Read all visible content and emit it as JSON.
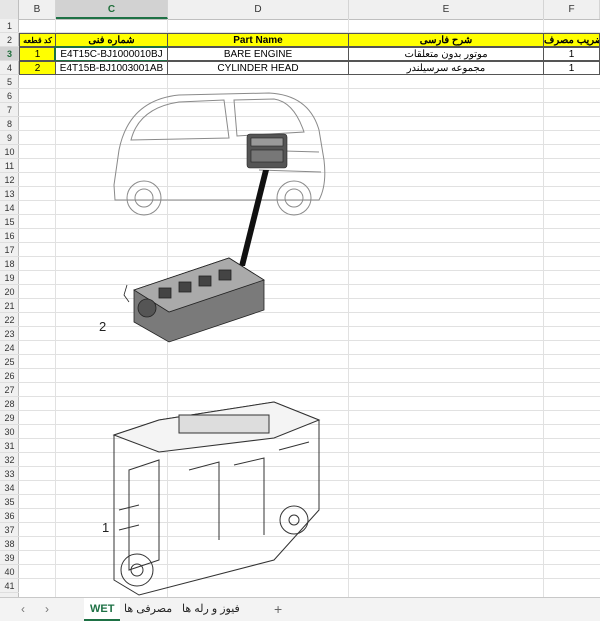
{
  "columns": [
    "B",
    "C",
    "D",
    "E",
    "F"
  ],
  "rows": [
    "1",
    "2",
    "3",
    "4",
    "5",
    "6",
    "7",
    "8",
    "9",
    "10",
    "11",
    "12",
    "13",
    "14",
    "15",
    "16",
    "17",
    "18",
    "19",
    "20",
    "21",
    "22",
    "23",
    "24",
    "25",
    "26",
    "27",
    "28",
    "29",
    "30",
    "31",
    "32",
    "33",
    "34",
    "35",
    "36",
    "37",
    "38",
    "39",
    "40",
    "41"
  ],
  "table": {
    "headers": {
      "b": "کد قطعه",
      "c": "شماره فنی",
      "d": "Part Name",
      "e": "شرح فارسی",
      "f": "ضریب مصرف"
    },
    "items": [
      {
        "b": "1",
        "c": "E4T15C-BJ1000010BJ",
        "d": "BARE ENGINE",
        "e": "موتور بدون متعلقات",
        "f": "1"
      },
      {
        "b": "2",
        "c": "E4T15B-BJ1003001AB",
        "d": "CYLINDER HEAD",
        "e": "مجموعه سرسیلندر",
        "f": "1"
      }
    ]
  },
  "figure": {
    "callout_1": "1",
    "callout_2": "2"
  },
  "tabs": {
    "active": "WET",
    "t2": "مصرفی ها",
    "t3": "فیوز و رله ها",
    "add": "+"
  }
}
